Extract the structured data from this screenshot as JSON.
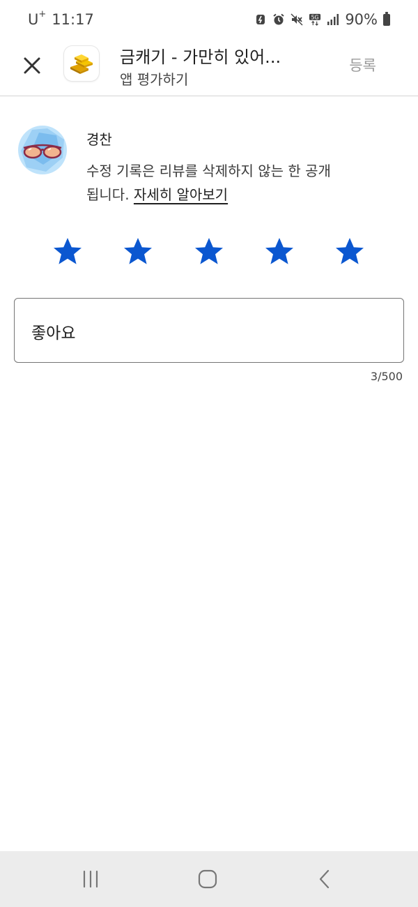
{
  "status_bar": {
    "carrier": "U",
    "carrier_sup": "+",
    "time": "11:17",
    "network": "5G",
    "battery_percent": "90%"
  },
  "app_bar": {
    "title": "금캐기 - 가만히 있어...",
    "subtitle": "앱 평가하기",
    "submit_label": "등록"
  },
  "profile": {
    "name": "경찬",
    "notice_text": "수정 기록은 리뷰를 삭제하지 않는 한 공개됩니다. ",
    "learn_more": "자세히 알아보기"
  },
  "rating": {
    "value": 5,
    "max": 5,
    "star_color": "#0b57d0"
  },
  "review": {
    "text": "좋아요",
    "char_count": "3/500"
  },
  "icons": {
    "close": "close-icon",
    "app": "gold-bars-icon",
    "recents": "recents-icon",
    "home": "home-icon",
    "back": "back-icon"
  }
}
